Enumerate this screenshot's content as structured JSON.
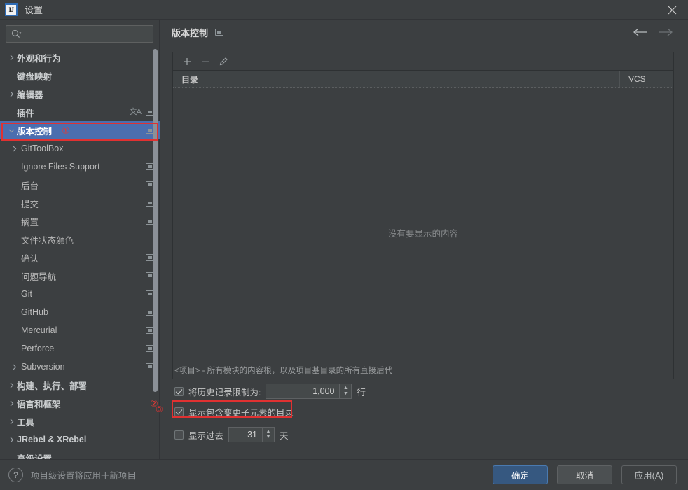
{
  "window": {
    "title": "设置",
    "logo_text": "IJ",
    "close_icon": "close-icon"
  },
  "sidebar": {
    "search": {
      "placeholder": "",
      "value": "",
      "icon": "search-icon"
    },
    "items": [
      {
        "label": "外观和行为",
        "level": 0,
        "expandable": true,
        "expanded": false,
        "icons": [],
        "selected": false
      },
      {
        "label": "键盘映射",
        "level": 0,
        "expandable": false,
        "expanded": false,
        "icons": [],
        "selected": false
      },
      {
        "label": "编辑器",
        "level": 0,
        "expandable": true,
        "expanded": false,
        "icons": [],
        "selected": false
      },
      {
        "label": "插件",
        "level": 0,
        "expandable": false,
        "expanded": false,
        "icons": [
          "translate-icon",
          "project-scope-icon"
        ],
        "selected": false
      },
      {
        "label": "版本控制",
        "level": 0,
        "expandable": true,
        "expanded": true,
        "icons": [
          "project-scope-icon"
        ],
        "selected": true,
        "marker": "①"
      },
      {
        "label": "GitToolBox",
        "level": 1,
        "expandable": true,
        "expanded": false,
        "icons": [],
        "selected": false
      },
      {
        "label": "Ignore Files Support",
        "level": 1,
        "expandable": false,
        "expanded": false,
        "icons": [
          "project-scope-icon"
        ],
        "selected": false
      },
      {
        "label": "后台",
        "level": 1,
        "expandable": false,
        "expanded": false,
        "icons": [
          "project-scope-icon"
        ],
        "selected": false
      },
      {
        "label": "提交",
        "level": 1,
        "expandable": false,
        "expanded": false,
        "icons": [
          "project-scope-icon"
        ],
        "selected": false
      },
      {
        "label": "搁置",
        "level": 1,
        "expandable": false,
        "expanded": false,
        "icons": [
          "project-scope-icon"
        ],
        "selected": false
      },
      {
        "label": "文件状态颜色",
        "level": 1,
        "expandable": false,
        "expanded": false,
        "icons": [],
        "selected": false
      },
      {
        "label": "确认",
        "level": 1,
        "expandable": false,
        "expanded": false,
        "icons": [
          "project-scope-icon"
        ],
        "selected": false
      },
      {
        "label": "问题导航",
        "level": 1,
        "expandable": false,
        "expanded": false,
        "icons": [
          "project-scope-icon"
        ],
        "selected": false
      },
      {
        "label": "Git",
        "level": 1,
        "expandable": false,
        "expanded": false,
        "icons": [
          "project-scope-icon"
        ],
        "selected": false
      },
      {
        "label": "GitHub",
        "level": 1,
        "expandable": false,
        "expanded": false,
        "icons": [
          "project-scope-icon"
        ],
        "selected": false
      },
      {
        "label": "Mercurial",
        "level": 1,
        "expandable": false,
        "expanded": false,
        "icons": [
          "project-scope-icon"
        ],
        "selected": false
      },
      {
        "label": "Perforce",
        "level": 1,
        "expandable": false,
        "expanded": false,
        "icons": [
          "project-scope-icon"
        ],
        "selected": false
      },
      {
        "label": "Subversion",
        "level": 1,
        "expandable": true,
        "expanded": false,
        "icons": [
          "project-scope-icon"
        ],
        "selected": false
      },
      {
        "label": "构建、执行、部署",
        "level": 0,
        "expandable": true,
        "expanded": false,
        "icons": [],
        "selected": false
      },
      {
        "label": "语言和框架",
        "level": 0,
        "expandable": true,
        "expanded": false,
        "icons": [],
        "selected": false,
        "marker": "②"
      },
      {
        "label": "工具",
        "level": 0,
        "expandable": true,
        "expanded": false,
        "icons": [],
        "selected": false
      },
      {
        "label": "JRebel & XRebel",
        "level": 0,
        "expandable": true,
        "expanded": false,
        "icons": [],
        "selected": false
      },
      {
        "label": "高级设置",
        "level": 0,
        "expandable": false,
        "expanded": false,
        "icons": [],
        "selected": false
      }
    ]
  },
  "panel": {
    "title": "版本控制",
    "title_icon": "project-scope-icon",
    "nav_back_icon": "arrow-left-icon",
    "nav_forward_icon": "arrow-right-icon",
    "toolbar": [
      {
        "icon": "plus-icon",
        "label": "+"
      },
      {
        "icon": "minus-icon",
        "label": "−"
      },
      {
        "icon": "edit-pencil-icon",
        "label": "✎"
      }
    ],
    "table": {
      "columns": [
        "目录",
        "VCS"
      ],
      "rows": [],
      "empty_message": "没有要显示的内容"
    },
    "hint": "<项目> - 所有模块的内容根，以及项目基目录的所有直接后代",
    "options": [
      {
        "id": "limit-history",
        "label": "将历史记录限制为:",
        "checked": true,
        "value": "1,000",
        "suffix": "行",
        "highlighted": false
      },
      {
        "id": "show-dirs-with-changed-descendants",
        "label": "显示包含变更子元素的目录",
        "checked": true,
        "value": "",
        "suffix": "",
        "highlighted": true,
        "marker": "③"
      },
      {
        "id": "show-past-days",
        "label": "显示过去",
        "checked": false,
        "value": "31",
        "suffix": "天",
        "highlighted": false
      }
    ]
  },
  "footer": {
    "help_icon": "help-icon",
    "note": "项目级设置将应用于新项目",
    "ok_label": "确定",
    "cancel_label": "取消",
    "apply_label": "应用(A)"
  },
  "colors": {
    "selection_blue": "#4b6eaf",
    "annotation_red": "#e03131",
    "primary_button": "#365880",
    "background": "#3c3f41"
  }
}
